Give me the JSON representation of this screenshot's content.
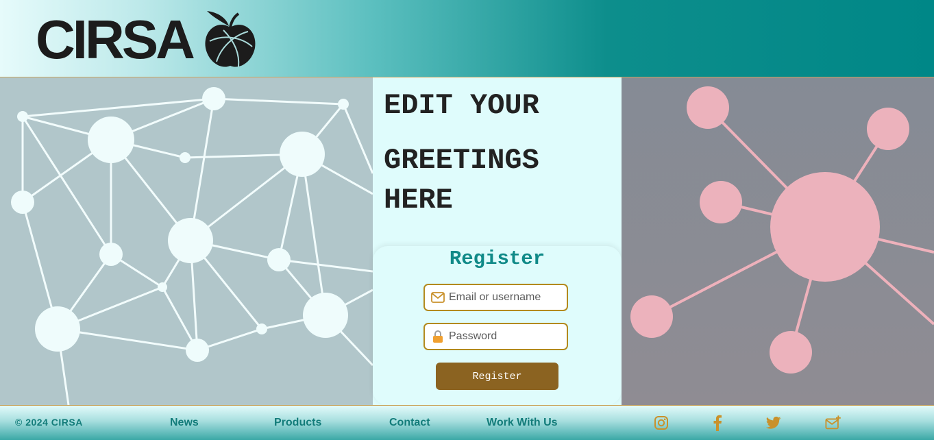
{
  "brand": {
    "name": "CIRSA"
  },
  "main": {
    "greeting": {
      "line1": "EDIT YOUR",
      "line2": "GREETINGS",
      "line3": "HERE"
    }
  },
  "register_form": {
    "title": "Register",
    "email_placeholder": "Email or username",
    "email_icon": "envelope-icon",
    "password_placeholder": "Password",
    "password_icon": "lock-icon",
    "submit_label": "Register"
  },
  "footer": {
    "copyright": "© 2024 CIRSA",
    "nav": [
      {
        "label": "News"
      },
      {
        "label": "Products"
      },
      {
        "label": "Contact"
      },
      {
        "label": "Work With Us"
      }
    ],
    "social": [
      {
        "icon": "instagram-icon"
      },
      {
        "icon": "facebook-icon"
      },
      {
        "icon": "twitter-icon"
      },
      {
        "icon": "mail-plus-icon"
      }
    ]
  },
  "colors": {
    "accent_teal": "#108a88",
    "button_brown": "#8b6321",
    "icon_gold": "#c9912b",
    "footer_text": "#137c7a"
  }
}
